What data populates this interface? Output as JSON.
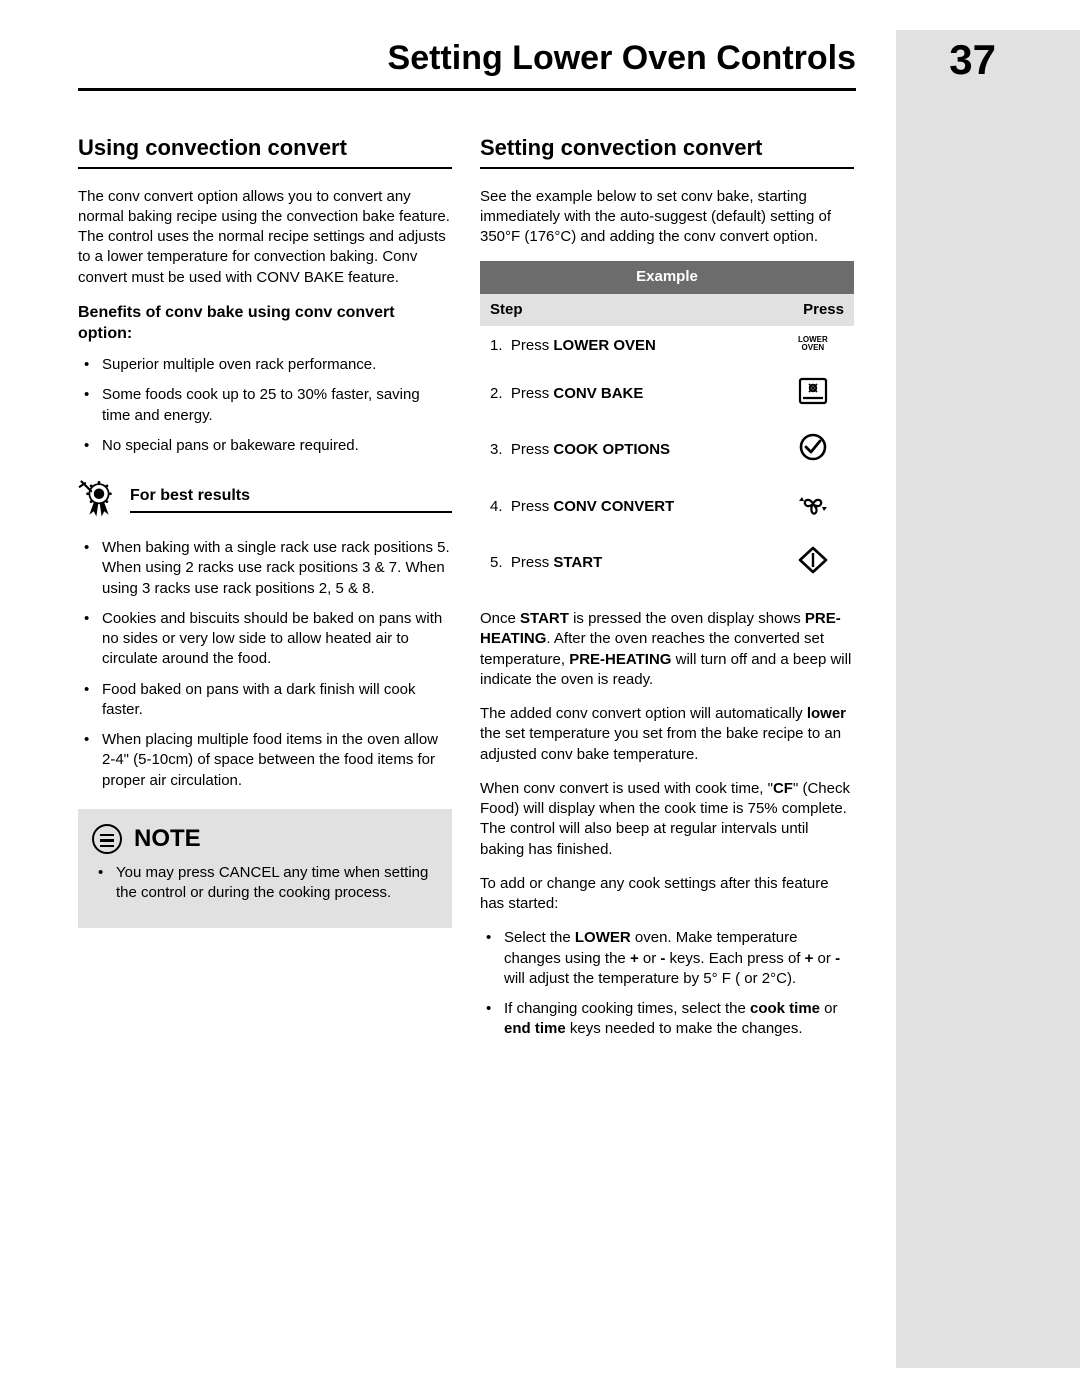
{
  "header": {
    "title": "Setting Lower Oven Controls",
    "page_number": "37"
  },
  "left": {
    "h2": "Using convection convert",
    "intro": "The conv convert option allows you to convert any normal baking recipe using the convection bake feature. The control uses the normal recipe settings and adjusts to a lower temperature for convection baking. Conv convert must be used with CONV BAKE feature.",
    "benefits_h": "Benefits of conv bake using conv convert option:",
    "benefits": [
      "Superior multiple oven rack performance.",
      "Some foods cook up to 25 to 30% faster, saving time and energy.",
      "No special pans or bakeware required."
    ],
    "best_h": "For best results",
    "best": [
      "When baking with a single rack use rack positions 5. When using 2 racks use rack positions 3 & 7. When using 3 racks use rack positions 2, 5 & 8.",
      "Cookies and biscuits should be baked on pans with no sides or very low side to allow heated air to circulate around the food.",
      "Food baked on pans with a dark finish will cook faster.",
      "When placing multiple food items in the oven allow 2-4\" (5-10cm) of space between the food items for proper air circulation."
    ],
    "note_label": "NOTE",
    "note_item": "You may press CANCEL any time when setting the control or during the cooking process."
  },
  "right": {
    "h2": "Setting convection convert",
    "intro": "See the example below to set conv bake, starting immediately with the auto-suggest (default) setting of 350°F (176°C) and adding the conv convert option.",
    "table": {
      "title": "Example",
      "col_step": "Step",
      "col_press": "Press",
      "rows": [
        {
          "n": "1.",
          "pre": "Press ",
          "bold": "LOWER OVEN",
          "icon": "lower-oven"
        },
        {
          "n": "2.",
          "pre": "Press ",
          "bold": "CONV BAKE",
          "icon": "conv-bake"
        },
        {
          "n": "3.",
          "pre": "Press ",
          "bold": "COOK OPTIONS",
          "icon": "cook-options"
        },
        {
          "n": "4.",
          "pre": "Press ",
          "bold": "CONV CONVERT",
          "icon": "conv-convert"
        },
        {
          "n": "5.",
          "pre": "Press ",
          "bold": "START",
          "icon": "start"
        }
      ]
    },
    "after1_parts": [
      "Once ",
      "START",
      " is pressed the oven display shows ",
      "PRE-HEATING",
      ". After the oven reaches the converted set temperature, ",
      "PRE-HEATING",
      " will turn off and a beep will indicate the oven is ready."
    ],
    "after2_parts": [
      "The added conv convert option will automatically ",
      "lower",
      " the set temperature you set from the bake recipe to an adjusted conv bake temperature."
    ],
    "after3_parts": [
      "When conv convert is used with cook time, \"",
      "CF",
      "\" (Check Food) will display when the cook time is 75% complete. The control will also beep at regular intervals until baking has finished."
    ],
    "after4": "To add or change any cook settings after this feature has started:",
    "change_list": [
      {
        "parts": [
          "Select the ",
          "LOWER",
          " oven. Make temperature changes using the ",
          "+",
          " or ",
          "-",
          " keys. Each press of ",
          "+",
          " or ",
          "-",
          " will adjust the temperature by 5° F ( or 2°C)."
        ]
      },
      {
        "parts": [
          "If changing cooking times, select the ",
          "cook time",
          " or ",
          "end time",
          " keys needed to make the changes."
        ]
      }
    ],
    "lower_oven_txt": "LOWER\nOVEN"
  }
}
